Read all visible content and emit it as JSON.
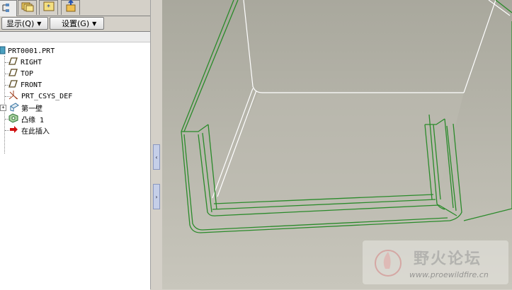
{
  "tabs": [
    {
      "name": "model-tree-tab",
      "icon": "model-tree-icon"
    },
    {
      "name": "folder-browser-tab",
      "icon": "folders-icon"
    },
    {
      "name": "favorites-tab",
      "icon": "favorites-star-icon"
    },
    {
      "name": "connections-tab",
      "icon": "connections-icon"
    }
  ],
  "toolbar": {
    "show_label": "显示(Q)",
    "settings_label": "设置(G)"
  },
  "tree": {
    "root": "PRT0001.PRT",
    "items": [
      {
        "label": "RIGHT",
        "icon": "datum-plane-icon"
      },
      {
        "label": "TOP",
        "icon": "datum-plane-icon"
      },
      {
        "label": "FRONT",
        "icon": "datum-plane-icon"
      },
      {
        "label": "PRT_CSYS_DEF",
        "icon": "coordinate-system-icon"
      },
      {
        "label": "第一壁",
        "icon": "first-wall-icon"
      },
      {
        "label": "凸缘 1",
        "icon": "flange-icon"
      },
      {
        "label": "在此插入",
        "icon": "insert-here-arrow-icon"
      }
    ]
  },
  "watermark": {
    "title": "野火论坛",
    "url": "www.proewildfire.cn"
  },
  "colors": {
    "panel": "#d4d0c8",
    "viewport_top": "#a9a89d",
    "viewport_bottom": "#c8c6bc",
    "model_edge": "#2a8a2a",
    "model_silhouette": "#ffffff"
  }
}
